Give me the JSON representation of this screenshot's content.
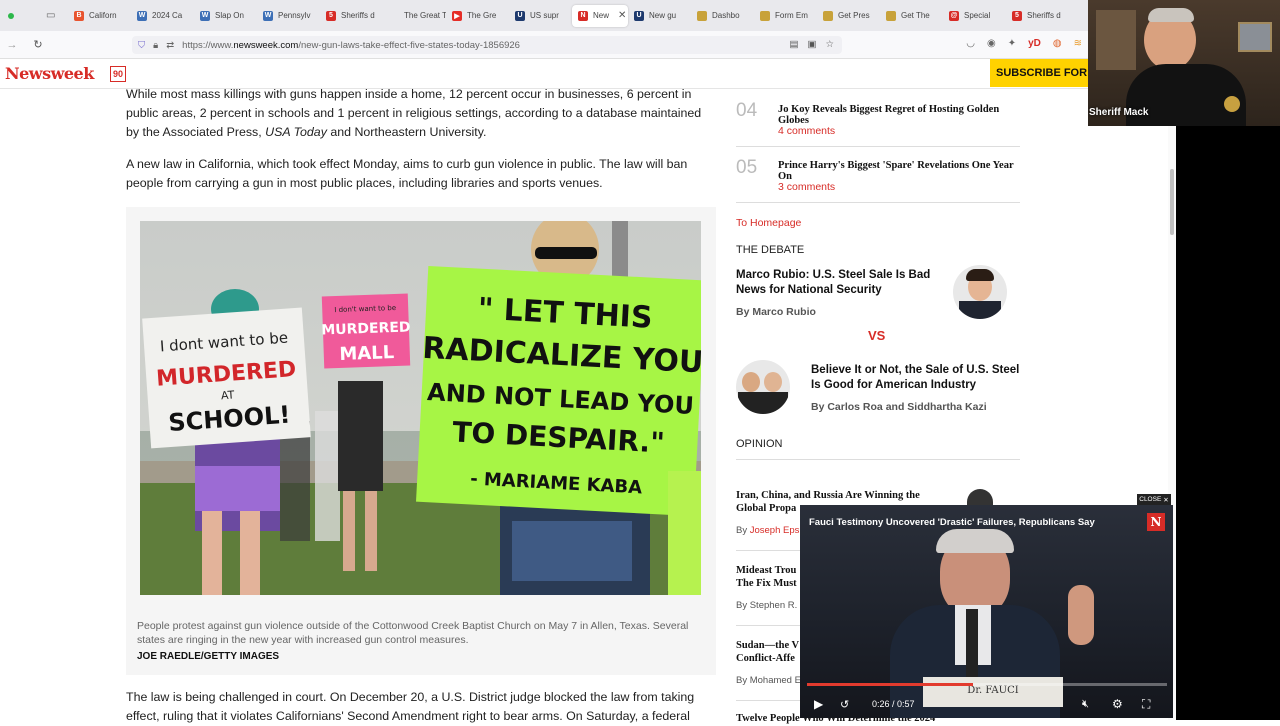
{
  "browser": {
    "tabs": [
      {
        "label": "Californ",
        "fav_color": "#e8542f",
        "fav_glyph": "B"
      },
      {
        "label": "2024 Ca",
        "fav_color": "#3d6fb6",
        "fav_glyph": "W"
      },
      {
        "label": "Slap On",
        "fav_color": "#3d6fb6",
        "fav_glyph": "W"
      },
      {
        "label": "Pennsylv",
        "fav_color": "#3d6fb6",
        "fav_glyph": "W"
      },
      {
        "label": "Sheriffs d",
        "fav_color": "#d72c27",
        "fav_glyph": "5"
      },
      {
        "label": "The Great Ta",
        "fav_color": "#e9e9ed",
        "fav_glyph": ""
      },
      {
        "label": "The Gre",
        "fav_color": "#e52d27",
        "fav_glyph": "▶"
      },
      {
        "label": "US supr",
        "fav_color": "#1e3a6e",
        "fav_glyph": "U"
      },
      {
        "label": "New",
        "fav_color": "#d72c27",
        "fav_glyph": "N"
      },
      {
        "label": "New gu",
        "fav_color": "#1e3a6e",
        "fav_glyph": "U"
      },
      {
        "label": "Dashbo",
        "fav_color": "#c8a23a",
        "fav_glyph": ""
      },
      {
        "label": "Form Em",
        "fav_color": "#c8a23a",
        "fav_glyph": ""
      },
      {
        "label": "Get Pres",
        "fav_color": "#c8a23a",
        "fav_glyph": ""
      },
      {
        "label": "Get The",
        "fav_color": "#c8a23a",
        "fav_glyph": ""
      },
      {
        "label": "Special",
        "fav_color": "#d72c27",
        "fav_glyph": "@"
      },
      {
        "label": "Sheriffs d",
        "fav_color": "#d72c27",
        "fav_glyph": "5"
      }
    ],
    "url_prefix": "https://www.",
    "url_host": "newsweek.com",
    "url_path": "/new-gun-laws-take-effect-five-states-today-1856926"
  },
  "header": {
    "logo": "Newsweek",
    "logo_badge": "90",
    "subscribe": "SUBSCRIBE FOR"
  },
  "article": {
    "para1_a": "While most mass killings with guns happen inside a home, 12 percent occur in businesses, 6 percent in public areas, 2 percent in schools and 1 percent in religious settings, according to a database maintained by the Associated Press, ",
    "para1_em": "USA Today",
    "para1_b": " and Northeastern University.",
    "para2": "A new law in California, which took effect Monday, aims to curb gun violence in public. The law will ban people from carrying a gun in most public places, including libraries and sports venues.",
    "photo_sign1": "I dont want to be MURDERED AT SCHOOL!",
    "photo_sign2": "I don't want to be MURDERED at the MALL",
    "photo_sign3_lines": [
      "\" LET THIS",
      "RADICALIZE YOU",
      "AND NOT LEAD YOU",
      "TO DESPAIR.\"",
      "- MARIAME KABA"
    ],
    "caption": "People protest against gun violence outside of the Cottonwood Creek Baptist Church on May 7 in Allen, Texas. Several states are ringing in the new year with increased gun control measures.",
    "credit": "JOE RAEDLE/GETTY IMAGES",
    "para3": "The law is being challenged in court. On December 20, a U.S. District judge blocked the law from taking effect, ruling that it violates Californians' Second Amendment right to bear arms. On Saturday, a federal"
  },
  "sidebar": {
    "ranked": [
      {
        "num": "04",
        "title": "Jo Koy Reveals Biggest Regret of Hosting Golden Globes",
        "comments": "4 comments"
      },
      {
        "num": "05",
        "title": "Prince Harry's Biggest 'Spare' Revelations One Year On",
        "comments": "3 comments"
      }
    ],
    "to_homepage": "To Homepage",
    "debate_label": "THE DEBATE",
    "debate1_title": "Marco Rubio: U.S. Steel Sale Is Bad News for National Security",
    "debate1_by": "By Marco Rubio",
    "vs": "VS",
    "debate2_title": "Believe It or Not, the Sale of U.S. Steel Is Good for American Industry",
    "debate2_by": "By Carlos Roa and Siddhartha Kazi",
    "opinion_label": "OPINION",
    "opinions": [
      {
        "title": "Iran, China, and Russia Are Winning the Global Propa",
        "by": "By ",
        "author": "Joseph Eps"
      },
      {
        "title": "Mideast Trou The Fix Must",
        "by": "By Stephen R.",
        "author": ""
      },
      {
        "title": "Sudan—the V Conflict-Affe",
        "by": "By Mohamed E",
        "author": ""
      },
      {
        "title": "Twelve People Who Will Determine the 2024",
        "by": "",
        "author": ""
      }
    ]
  },
  "webcam": {
    "name": "Sheriff Mack"
  },
  "video": {
    "close_label": "CLOSE",
    "title": "Fauci Testimony Uncovered 'Drastic' Failures, Republicans Say",
    "brand": "N",
    "time": "0:26 / 0:57",
    "progress": 0.46,
    "nameplate": "Dr. FAUCI"
  },
  "colors": {
    "accent": "#d72c27",
    "subscribe": "#ffd200",
    "sign_green": "#a7f545",
    "sign_pink": "#f05a9a"
  }
}
